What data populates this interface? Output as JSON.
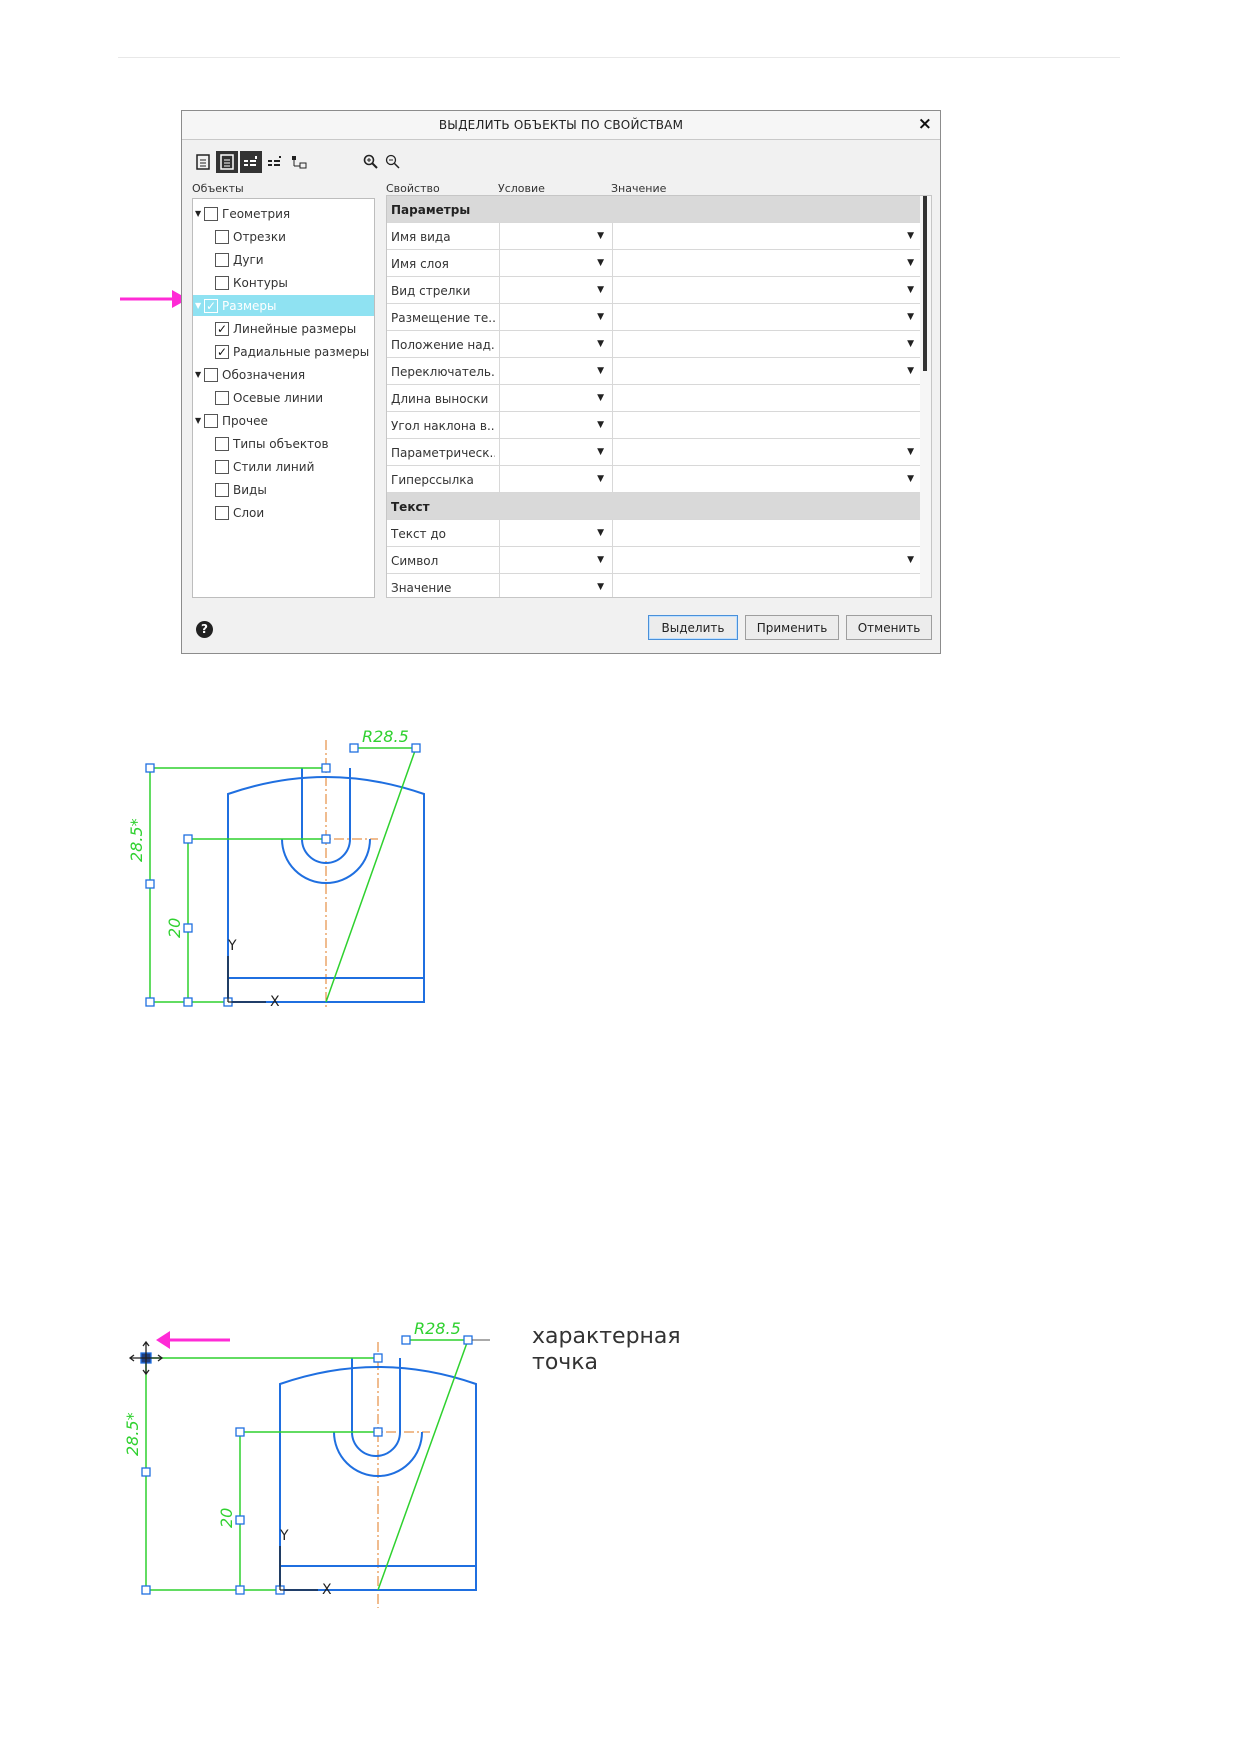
{
  "dialog": {
    "title": "ВЫДЕЛИТЬ ОБЪЕКТЫ ПО СВОЙСТВАМ",
    "close_glyph": "×",
    "toolbar_icons": [
      "document-icon",
      "document-icon",
      "tree-expand-icon",
      "tree-collapse-icon",
      "hierarchy-icon",
      "zoom-in-icon",
      "zoom-out-icon"
    ],
    "objects_label": "Объекты",
    "column_headers": {
      "property": "Свойство",
      "condition": "Условие",
      "value": "Значение"
    },
    "tree": [
      {
        "label": "Геометрия",
        "expanded": true,
        "checked": false,
        "level": 0
      },
      {
        "label": "Отрезки",
        "checked": false,
        "level": 1
      },
      {
        "label": "Дуги",
        "checked": false,
        "level": 1
      },
      {
        "label": "Контуры",
        "checked": false,
        "level": 1
      },
      {
        "label": "Размеры",
        "expanded": true,
        "checked": true,
        "level": 0,
        "selected": true
      },
      {
        "label": "Линейные размеры",
        "checked": true,
        "level": 1
      },
      {
        "label": "Радиальные размеры",
        "checked": true,
        "level": 1
      },
      {
        "label": "Обозначения",
        "expanded": true,
        "checked": false,
        "level": 0
      },
      {
        "label": "Осевые линии",
        "checked": false,
        "level": 1
      },
      {
        "label": "Прочее",
        "expanded": true,
        "checked": false,
        "level": 0
      },
      {
        "label": "Типы объектов",
        "checked": false,
        "level": 1
      },
      {
        "label": "Стили линий",
        "checked": false,
        "level": 1
      },
      {
        "label": "Виды",
        "checked": false,
        "level": 1
      },
      {
        "label": "Слои",
        "checked": false,
        "level": 1
      }
    ],
    "grid": [
      {
        "section": "Параметры"
      },
      {
        "property": "Имя вида",
        "value_dropdown": true
      },
      {
        "property": "Имя слоя",
        "value_dropdown": true
      },
      {
        "property": "Вид стрелки",
        "value_dropdown": true
      },
      {
        "property": "Размещение те...",
        "value_dropdown": true
      },
      {
        "property": "Положение над...",
        "value_dropdown": true
      },
      {
        "property": "Переключатель...",
        "value_dropdown": true
      },
      {
        "property": "Длина выноски",
        "value_dropdown": false
      },
      {
        "property": "Угол наклона в...",
        "value_dropdown": false
      },
      {
        "property": "Параметрическ...",
        "value_dropdown": true
      },
      {
        "property": "Гиперссылка",
        "value_dropdown": true
      },
      {
        "section": "Текст"
      },
      {
        "property": "Текст до",
        "value_dropdown": false
      },
      {
        "property": "Символ",
        "value_dropdown": true
      },
      {
        "property": "Значение",
        "value_dropdown": false
      }
    ],
    "buttons": {
      "select": "Выделить",
      "apply": "Применить",
      "cancel": "Отменить"
    },
    "help_glyph": "?"
  },
  "drawing1": {
    "radius_label": "R28.5",
    "dim_left": "28.5*",
    "dim_inner": "20",
    "axis_y": "Y",
    "axis_x": "X"
  },
  "drawing2": {
    "radius_label": "R28.5",
    "dim_left": "28.5*",
    "dim_inner": "20",
    "axis_y": "Y",
    "axis_x": "X"
  },
  "annotation": {
    "line1": "характерная",
    "line2": "точка"
  },
  "colors": {
    "accent_pink": "#ff2bd6",
    "geometry_blue": "#1f6fe0",
    "dimension_green": "#2fd12f",
    "axis_orange": "#e07a1f",
    "selection_cyan": "#8fe2f2"
  }
}
